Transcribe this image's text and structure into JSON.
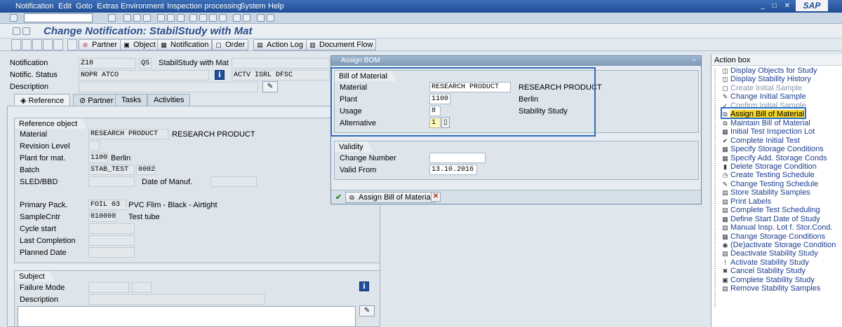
{
  "menu": [
    "Notification",
    "Edit",
    "Goto",
    "Extras",
    "Environment",
    "Inspection processing",
    "System",
    "Help"
  ],
  "sap_logo": "SAP",
  "title": "Change Notification: StabilStudy with Mat",
  "app_toolbar": {
    "partner": "Partner",
    "object": "Object",
    "notification": "Notification",
    "order": "Order",
    "action_log": "Action Log",
    "document_flow": "Document Flow"
  },
  "header": {
    "notification_label": "Notification",
    "notification_type": "Z10",
    "notification_qs": "QS",
    "notification_desc": "StabilStudy with Mat",
    "status_label": "Notific. Status",
    "status_value": "NOPR ATCO",
    "status_value2": "ACTV ISRL DFSC",
    "description_label": "Description"
  },
  "tabs": [
    "Reference",
    "Partner",
    "Tasks",
    "Activities"
  ],
  "reference_object": {
    "title": "Reference object",
    "material_label": "Material",
    "material_value": "RESEARCH PRODUCT",
    "material_desc": "RESEARCH PRODUCT",
    "revision_label": "Revision Level",
    "plant_label": "Plant for mat.",
    "plant_value": "1100",
    "plant_desc": "Berlin",
    "batch_label": "Batch",
    "batch_value": "STAB_TEST",
    "batch_value2": "0002",
    "sled_label": "SLED/BBD",
    "date_manuf_label": "Date of Manuf.",
    "primary_pack_label": "Primary Pack.",
    "primary_pack_value": "FOIL 03",
    "primary_pack_desc": "PVC Flim - Black - Airtight",
    "sample_cntr_label": "SampleCntr",
    "sample_cntr_value": "010000",
    "sample_cntr_desc": "Test tube",
    "cycle_start_label": "Cycle start",
    "last_completion_label": "Last Completion",
    "planned_date_label": "Planned Date"
  },
  "subject": {
    "title": "Subject",
    "failure_mode_label": "Failure Mode",
    "description_label": "Description"
  },
  "popup": {
    "title": "Assign BOM",
    "bom_group_title": "Bill of Material",
    "material_label": "Material",
    "material_value": "RESEARCH PRODUCT",
    "material_desc": "RESEARCH PRODUCT",
    "plant_label": "Plant",
    "plant_value": "1100",
    "plant_desc": "Berlin",
    "usage_label": "Usage",
    "usage_value": "8",
    "usage_desc": "Stability Study",
    "alternative_label": "Alternative",
    "alternative_value": "1",
    "validity_title": "Validity",
    "change_number_label": "Change Number",
    "valid_from_label": "Valid From",
    "valid_from_value": "13.10.2016",
    "assign_button": "Assign Bill of Material"
  },
  "action_box": {
    "header": "Action box",
    "items": [
      {
        "label": "Display Objects for Study",
        "icon": "display-icon",
        "enabled": true
      },
      {
        "label": "Display Stability History",
        "icon": "history-icon",
        "enabled": true
      },
      {
        "label": "Create Initial Sample",
        "icon": "sample-icon",
        "enabled": false
      },
      {
        "label": "Change Initial Sample",
        "icon": "change-icon",
        "enabled": true
      },
      {
        "label": "Confirm Initial Sample",
        "icon": "confirm-icon",
        "enabled": false
      },
      {
        "label": "Assign Bill of Material",
        "icon": "bom-icon",
        "enabled": true,
        "selected": true
      },
      {
        "label": "Maintain Bill of Material",
        "icon": "bom-maintain-icon",
        "enabled": true
      },
      {
        "label": "Initial Test Inspection Lot",
        "icon": "inspection-icon",
        "enabled": true
      },
      {
        "label": "Complete Initial Test",
        "icon": "complete-icon",
        "enabled": true
      },
      {
        "label": "Specify Storage Conditions",
        "icon": "storage-icon",
        "enabled": true
      },
      {
        "label": "Specify Add. Storage Conds",
        "icon": "storage-add-icon",
        "enabled": true
      },
      {
        "label": "Delete Storage Condition",
        "icon": "delete-icon",
        "enabled": true
      },
      {
        "label": "Create Testing Schedule",
        "icon": "schedule-create-icon",
        "enabled": true
      },
      {
        "label": "Change Testing Schedule",
        "icon": "schedule-change-icon",
        "enabled": true
      },
      {
        "label": "Store Stability Samples",
        "icon": "store-icon",
        "enabled": true
      },
      {
        "label": "Print Labels",
        "icon": "print-icon",
        "enabled": true
      },
      {
        "label": "Complete Test Scheduling",
        "icon": "schedule-complete-icon",
        "enabled": true
      },
      {
        "label": "Define Start Date of Study",
        "icon": "calendar-icon",
        "enabled": true
      },
      {
        "label": "Manual Insp. Lot f. Stor.Cond.",
        "icon": "manual-lot-icon",
        "enabled": true
      },
      {
        "label": "Change Storage Conditions",
        "icon": "storage-change-icon",
        "enabled": true
      },
      {
        "label": "(De)activate Storage Condition",
        "icon": "lock-icon",
        "enabled": true
      },
      {
        "label": "Deactivate Stability Study",
        "icon": "deactivate-icon",
        "enabled": true
      },
      {
        "label": "Activate Stability Study",
        "icon": "activate-icon",
        "enabled": true
      },
      {
        "label": "Cancel Stability Study",
        "icon": "cancel-icon",
        "enabled": true
      },
      {
        "label": "Complete Stability Study",
        "icon": "complete-study-icon",
        "enabled": true
      },
      {
        "label": "Remove Stability Samples",
        "icon": "remove-icon",
        "enabled": true
      }
    ]
  }
}
